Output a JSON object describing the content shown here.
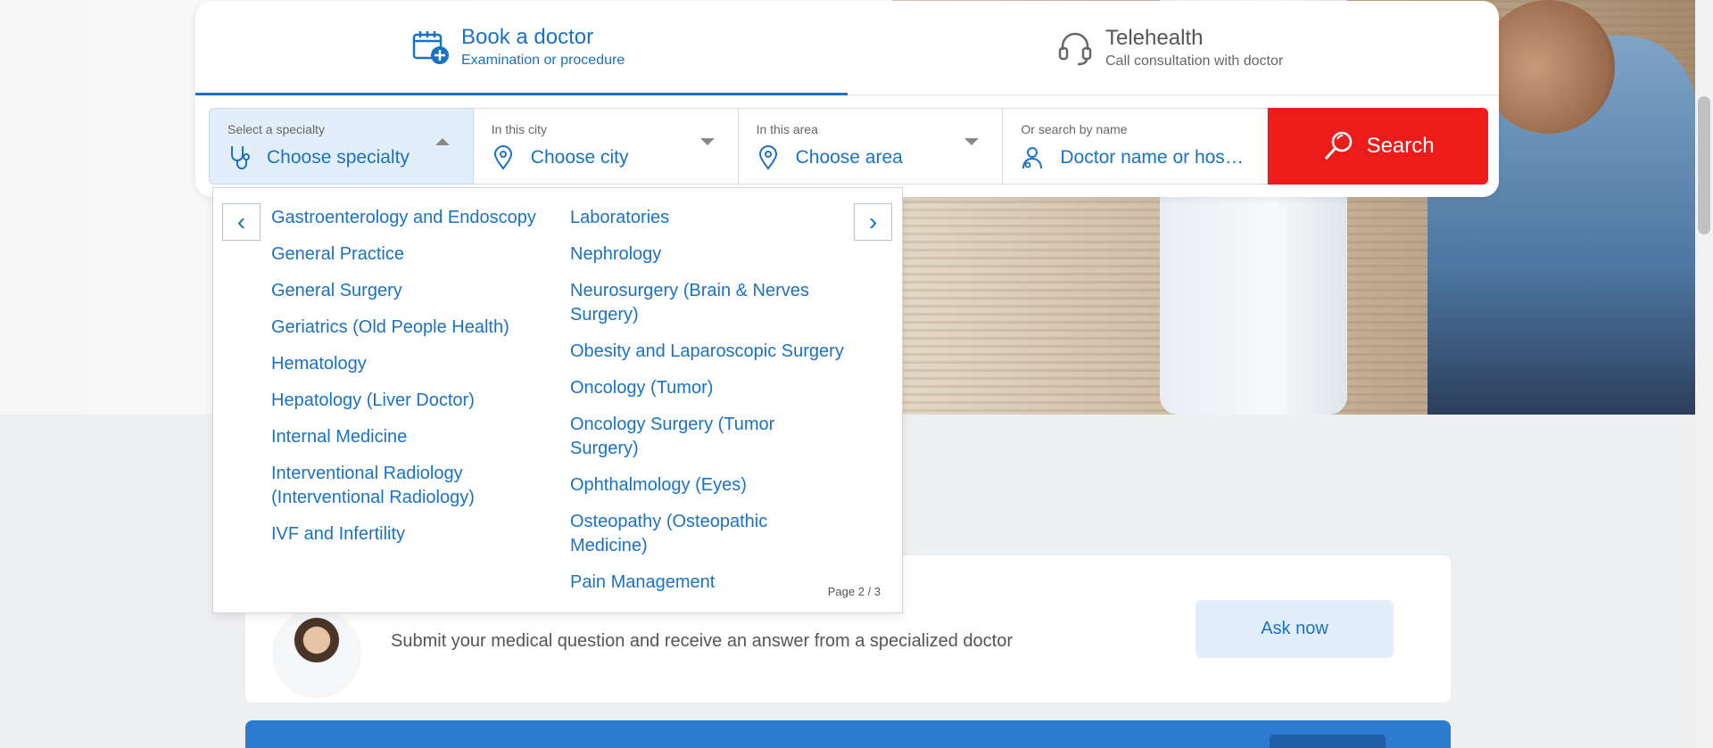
{
  "tabs": {
    "book": {
      "title": "Book a doctor",
      "subtitle": "Examination or procedure"
    },
    "telehealth": {
      "title": "Telehealth",
      "subtitle": "Call consultation with doctor"
    }
  },
  "search": {
    "specialty": {
      "label": "Select a specialty",
      "value": "Choose specialty"
    },
    "city": {
      "label": "In this city",
      "value": "Choose city"
    },
    "area": {
      "label": "In this area",
      "value": "Choose area"
    },
    "name": {
      "label": "Or search by name",
      "placeholder": "Doctor name or hospi…"
    },
    "button_label": "Search"
  },
  "dropdown": {
    "prev_glyph": "‹",
    "next_glyph": "›",
    "left_column": [
      "Gastroenterology and Endoscopy",
      "General Practice",
      "General Surgery",
      "Geriatrics (Old People Health)",
      "Hematology",
      "Hepatology (Liver Doctor)",
      "Internal Medicine",
      "Interventional Radiology (Interventional Radiology)",
      "IVF and Infertility"
    ],
    "right_column": [
      "Laboratories",
      "Nephrology",
      "Neurosurgery (Brain & Nerves Surgery)",
      "Obesity and Laparoscopic Surgery",
      "Oncology (Tumor)",
      "Oncology Surgery (Tumor Surgery)",
      "Ophthalmology (Eyes)",
      "Osteopathy (Osteopathic Medicine)",
      "Pain Management"
    ],
    "page_indicator": "Page 2 / 3"
  },
  "qa": {
    "description": "Submit your medical question and receive an answer from a specialized doctor",
    "button_label": "Ask now"
  },
  "colors": {
    "primary": "#1a72c4",
    "search": "#ee1b1b",
    "active_field": "#e3eefb"
  }
}
